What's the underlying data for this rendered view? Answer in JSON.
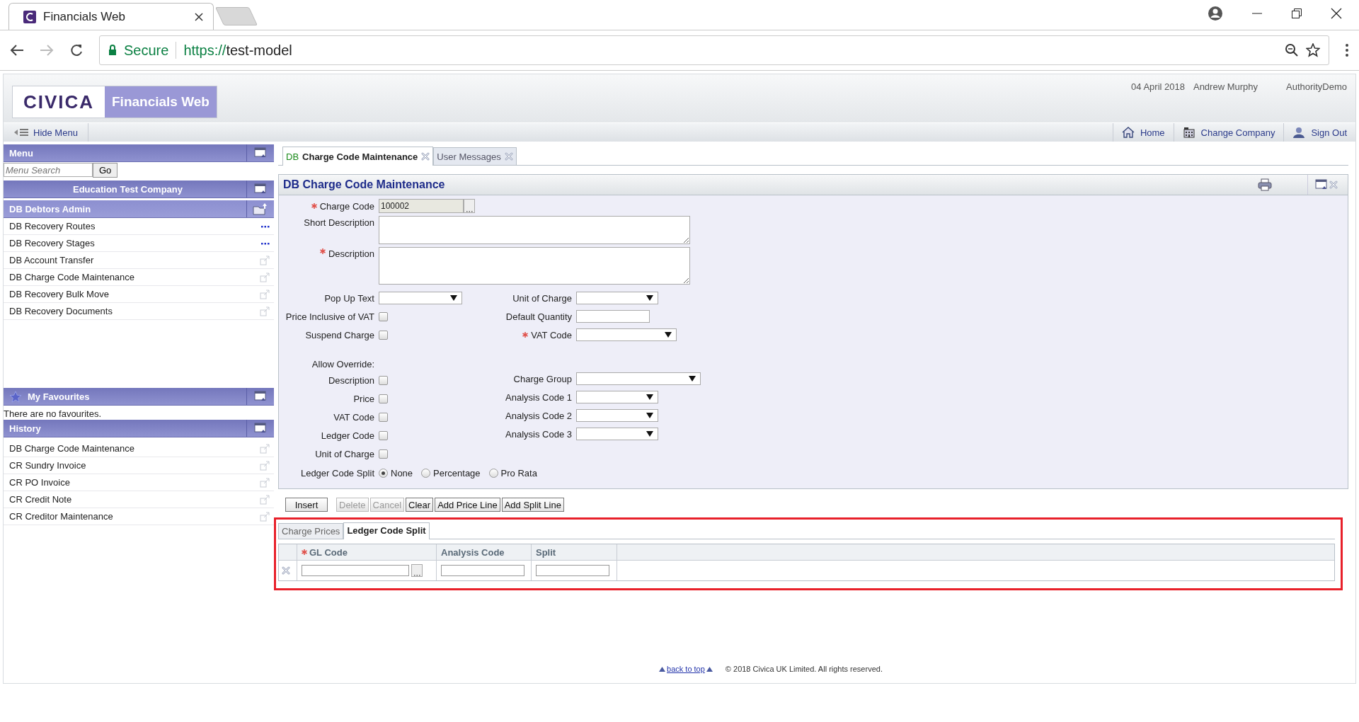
{
  "browser": {
    "tab_title": "Financials Web",
    "secure_label": "Secure",
    "url_scheme": "https://",
    "url_host": "test-model"
  },
  "header": {
    "logo": "CIVICA",
    "app_name": "Financials Web",
    "date": "04 April 2018",
    "user": "Andrew Murphy",
    "authority": "AuthorityDemo"
  },
  "nav": {
    "hide_menu": "Hide Menu",
    "links": [
      {
        "label": "Home",
        "kind": "home"
      },
      {
        "label": "Change Company",
        "kind": "company"
      },
      {
        "label": "Sign Out",
        "kind": "signout"
      }
    ]
  },
  "sidebar": {
    "menu_title": "Menu",
    "search_placeholder": "Menu Search",
    "go": "Go",
    "company": "Education Test Company",
    "section": "DB Debtors Admin",
    "items": [
      {
        "label": "DB Recovery Routes",
        "kind": "more"
      },
      {
        "label": "DB Recovery Stages",
        "kind": "more"
      },
      {
        "label": "DB Account Transfer",
        "kind": "link"
      },
      {
        "label": "DB Charge Code Maintenance",
        "kind": "link"
      },
      {
        "label": "DB Recovery Bulk Move",
        "kind": "link"
      },
      {
        "label": "DB Recovery Documents",
        "kind": "link"
      }
    ],
    "favourites_title": "My Favourites",
    "favourites_empty": "There are no favourites.",
    "history_title": "History",
    "history": [
      {
        "label": "DB Charge Code Maintenance"
      },
      {
        "label": "CR Sundry Invoice"
      },
      {
        "label": "CR PO Invoice"
      },
      {
        "label": "CR Credit Note"
      },
      {
        "label": "CR Creditor Maintenance"
      }
    ]
  },
  "tabs": [
    {
      "module": "DB",
      "label": "Charge Code Maintenance",
      "selected": true
    },
    {
      "label": "User Messages",
      "selected": false
    }
  ],
  "panel_title": "DB Charge Code Maintenance",
  "top_fields": [
    {
      "label": "Charge Code",
      "kind": "lookup",
      "required": true,
      "value": "100002"
    },
    {
      "label": "Short Description",
      "kind": "textarea",
      "required": false
    },
    {
      "label": "Description",
      "kind": "textarea",
      "required": true
    }
  ],
  "left_fields": [
    {
      "label": "Pop Up Text",
      "kind": "select",
      "required": false
    },
    {
      "label": "Price Inclusive of VAT",
      "kind": "checkbox",
      "checked": false
    },
    {
      "label": "Suspend Charge",
      "kind": "checkbox",
      "checked": false
    },
    {
      "label": "Allow Override:",
      "kind": "heading"
    },
    {
      "label": "Description",
      "kind": "checkbox",
      "checked": false
    },
    {
      "label": "Price",
      "kind": "checkbox",
      "checked": false
    },
    {
      "label": "VAT Code",
      "kind": "checkbox",
      "checked": false
    },
    {
      "label": "Ledger Code",
      "kind": "checkbox",
      "checked": false
    },
    {
      "label": "Unit of Charge",
      "kind": "checkbox",
      "checked": false
    }
  ],
  "right_fields": [
    {
      "label": "Unit of Charge",
      "kind": "select",
      "required": false
    },
    {
      "label": "Default Quantity",
      "kind": "text",
      "required": false
    },
    {
      "label": "VAT Code",
      "kind": "select",
      "required": true
    },
    {
      "label": "Charge Group",
      "kind": "wide_select",
      "required": false
    },
    {
      "label": "Analysis Code 1",
      "kind": "select",
      "required": false
    },
    {
      "label": "Analysis Code 2",
      "kind": "select",
      "required": false
    },
    {
      "label": "Analysis Code 3",
      "kind": "select",
      "required": false
    }
  ],
  "ledger_split": {
    "label": "Ledger Code Split",
    "options": [
      {
        "label": "None",
        "selected": true
      },
      {
        "label": "Percentage",
        "selected": false
      },
      {
        "label": "Pro Rata",
        "selected": false
      }
    ]
  },
  "buttons": [
    {
      "label": "Insert",
      "disabled": false
    },
    {
      "label": "Delete",
      "disabled": true
    },
    {
      "label": "Cancel",
      "disabled": true
    },
    {
      "label": "Clear",
      "disabled": false
    },
    {
      "label": "Add Price Line",
      "disabled": false
    },
    {
      "label": "Add Split Line",
      "disabled": false
    }
  ],
  "subtabs": [
    {
      "label": "Charge Prices",
      "selected": false
    },
    {
      "label": "Ledger Code Split",
      "selected": true
    }
  ],
  "grid_columns": [
    {
      "label": "GL Code",
      "required": true,
      "kind": "lookup"
    },
    {
      "label": "Analysis Code",
      "required": false,
      "kind": "text"
    },
    {
      "label": "Split",
      "required": false,
      "kind": "text"
    }
  ],
  "footer": {
    "back_to_top": "back to top",
    "copyright": "© 2018 Civica UK Limited. All rights reserved."
  }
}
